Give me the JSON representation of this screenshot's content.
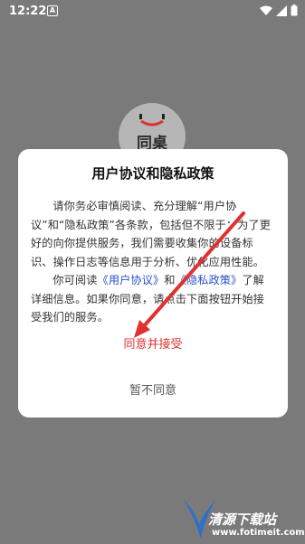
{
  "status_bar": {
    "time": "12:22",
    "app_icon_letter": "A"
  },
  "splash": {
    "logo_text": "同桌"
  },
  "dialog": {
    "title": "用户协议和隐私政策",
    "paragraph1": "请你务必审慎阅读、充分理解“用户协议”和“隐私政策”各条款，包括但不限于：为了更好的向你提供服务，我们需要收集你的设备标识、操作日志等信息用于分析、优化应用性能。",
    "paragraph2_prefix": "你可阅读",
    "user_agreement_link": "《用户协议》",
    "paragraph2_and": "和",
    "privacy_policy_link": "《隐私政策》",
    "paragraph2_suffix": "了解详细信息。如果你同意，请点击下面按钮开始接受我们的服务。",
    "agree_label": "同意并接受",
    "disagree_label": "暂不同意"
  },
  "watermark": {
    "title": "清源下载站",
    "url": "www.fotimeit.com"
  },
  "colors": {
    "overlay": "#7a7a7a",
    "agree": "#e03131",
    "link": "#2a50c8",
    "arrow": "#e03131"
  }
}
